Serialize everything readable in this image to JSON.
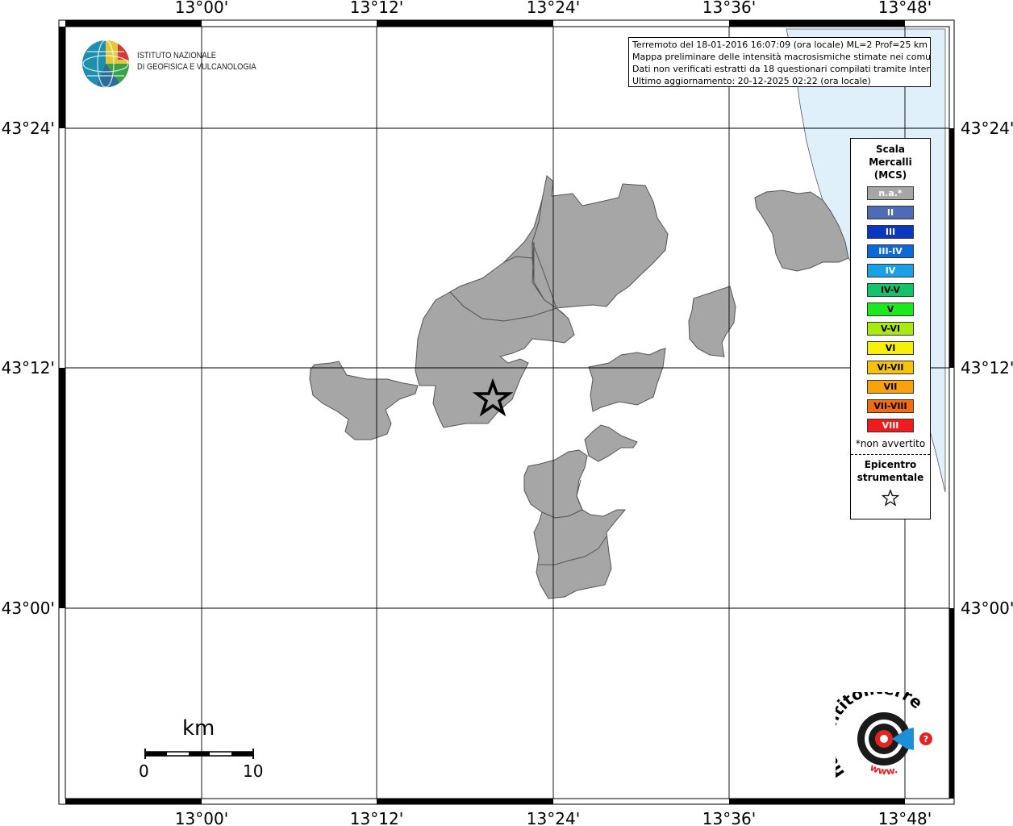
{
  "map": {
    "lon_ticks": [
      "13°00'",
      "13°12'",
      "13°24'",
      "13°36'",
      "13°48'"
    ],
    "lat_ticks": [
      "43°24'",
      "43°12'",
      "43°00'"
    ],
    "epicenter": {
      "lon": 13.33,
      "lat": 43.185
    },
    "sea_color": "#e0f0fb",
    "land_color": "#a6a6a6"
  },
  "info": {
    "line1": "Terremoto del 18-01-2016 16:07:09 (ora locale) ML=2 Prof=25 km",
    "line2": "Mappa preliminare delle intensità macrosismiche stimate nei comuni",
    "line3": "Dati non verificati estratti da 18 questionari compilati tramite Internet.",
    "line4": "Ultimo aggiornamento: 20-12-2025 02:22 (ora locale)"
  },
  "legend": {
    "title_line1": "Scala",
    "title_line2": "Mercalli",
    "title_line3": "(MCS)",
    "items": [
      {
        "label": "n.a.*",
        "color": "#a6a6a6",
        "text_color": "#ffffff"
      },
      {
        "label": "II",
        "color": "#4f6bb5",
        "text_color": "#ffffff"
      },
      {
        "label": "III",
        "color": "#0a36c0",
        "text_color": "#ffffff"
      },
      {
        "label": "III-IV",
        "color": "#0b6ad6",
        "text_color": "#ffffff"
      },
      {
        "label": "IV",
        "color": "#1aa0e6",
        "text_color": "#ffffff"
      },
      {
        "label": "IV-V",
        "color": "#12c36a",
        "text_color": "#000000"
      },
      {
        "label": "V",
        "color": "#1de81d",
        "text_color": "#000000"
      },
      {
        "label": "V-VI",
        "color": "#a8ea10",
        "text_color": "#000000"
      },
      {
        "label": "VI",
        "color": "#f5ef0a",
        "text_color": "#000000"
      },
      {
        "label": "VI-VII",
        "color": "#f5c40a",
        "text_color": "#000000"
      },
      {
        "label": "VII",
        "color": "#f8a20c",
        "text_color": "#000000"
      },
      {
        "label": "VII-VIII",
        "color": "#f36c10",
        "text_color": "#000000"
      },
      {
        "label": "VIII",
        "color": "#ee1c1c",
        "text_color": "#ffffff"
      }
    ],
    "note": "*non avvertito",
    "epicenter_line1": "Epicentro",
    "epicenter_line2": "strumentale"
  },
  "logos": {
    "ingv_line1": "ISTITUTO NAZIONALE",
    "ingv_line2": "DI GEOFISICA E VULCANOLOGIA",
    "hsit_text": "haisentitoilterremoto.it",
    "hsit_www": "www."
  },
  "scalebar": {
    "unit": "km",
    "start": "0",
    "end": "10"
  }
}
